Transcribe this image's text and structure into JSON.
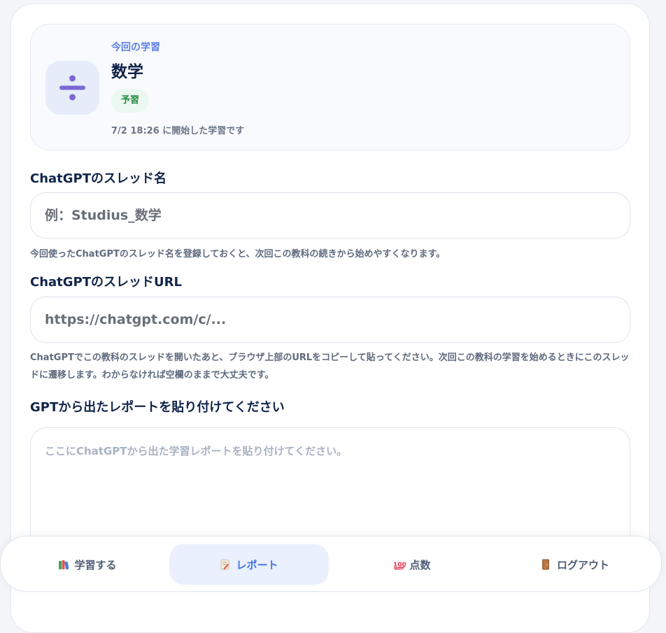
{
  "session": {
    "eyebrow": "今回の学習",
    "subject": "数学",
    "subject_icon": "divide-icon",
    "mode_badge": "予習",
    "started_text": "7/2 18:26 に開始した学習です"
  },
  "thread_name": {
    "label": "ChatGPTのスレッド名",
    "placeholder": "例：Studius_数学",
    "value": "",
    "help": "今回使ったChatGPTのスレッド名を登録しておくと、次回この教科の続きから始めやすくなります。"
  },
  "thread_url": {
    "label": "ChatGPTのスレッドURL",
    "placeholder": "https://chatgpt.com/c/...",
    "value": "",
    "help": "ChatGPTでこの教科のスレッドを開いたあと、ブラウザ上部のURLをコピーして貼ってください。次回この教科の学習を始めるときにこのスレッドに遷移します。わからなければ空欄のままで大丈夫です。"
  },
  "report": {
    "label": "GPTから出たレポートを貼り付けてください",
    "placeholder": "ここにChatGPTから出た学習レポートを貼り付けてください。",
    "value": ""
  },
  "nav": {
    "items": [
      {
        "label": "学習する",
        "icon": "books-icon",
        "active": false
      },
      {
        "label": "レポート",
        "icon": "memo-icon",
        "active": true
      },
      {
        "label": "点数",
        "icon": "hundred-points-icon",
        "active": false
      },
      {
        "label": "ログアウト",
        "icon": "door-icon",
        "active": false
      }
    ]
  },
  "colors": {
    "accent": "#3f72e6",
    "eyebrow": "#5b7fe0",
    "badge_bg": "#ebf8ef",
    "badge_text": "#1f8a3e",
    "icon_purple": "#7b68d6"
  }
}
